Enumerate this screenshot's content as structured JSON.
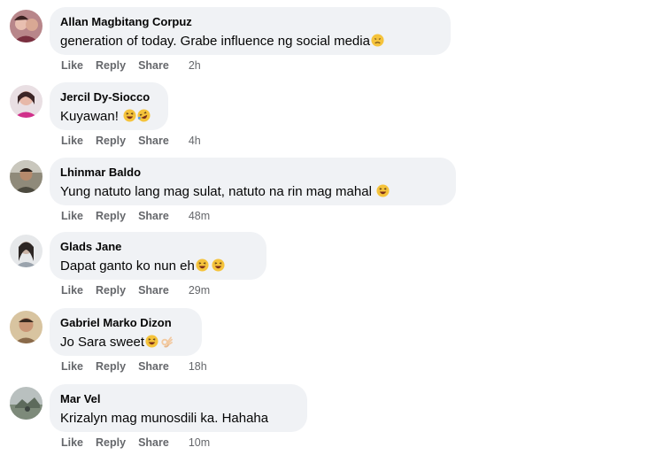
{
  "comments": [
    {
      "author": "Allan Magbitang Corpuz",
      "text": "generation of today. Grabe influence ng social media",
      "emojis": [
        "disappointed-emoji"
      ],
      "actions": {
        "like": "Like",
        "reply": "Reply",
        "share": "Share"
      },
      "time": "2h"
    },
    {
      "author": "Jercil Dy-Siocco",
      "text": "Kuyawan! ",
      "emojis": [
        "laughing-emoji",
        "rofl-emoji"
      ],
      "actions": {
        "like": "Like",
        "reply": "Reply",
        "share": "Share"
      },
      "time": "4h"
    },
    {
      "author": "Lhinmar Baldo",
      "text": "Yung natuto lang mag sulat, natuto na rin mag mahal ",
      "emojis": [
        "laughing-emoji"
      ],
      "actions": {
        "like": "Like",
        "reply": "Reply",
        "share": "Share"
      },
      "time": "48m"
    },
    {
      "author": "Glads Jane",
      "text": "Dapat ganto ko nun eh",
      "emojis": [
        "laughing-emoji",
        "laughing-emoji"
      ],
      "actions": {
        "like": "Like",
        "reply": "Reply",
        "share": "Share"
      },
      "time": "29m"
    },
    {
      "author": "Gabriel Marko Dizon",
      "text": "Jo Sara sweet",
      "emojis": [
        "laughing-emoji",
        "ok-hand-emoji"
      ],
      "actions": {
        "like": "Like",
        "reply": "Reply",
        "share": "Share"
      },
      "time": "18h"
    },
    {
      "author": "Mar Vel",
      "text": "Krizalyn mag munosdili ka. Hahaha",
      "emojis": [],
      "actions": {
        "like": "Like",
        "reply": "Reply",
        "share": "Share"
      },
      "time": "10m"
    }
  ]
}
